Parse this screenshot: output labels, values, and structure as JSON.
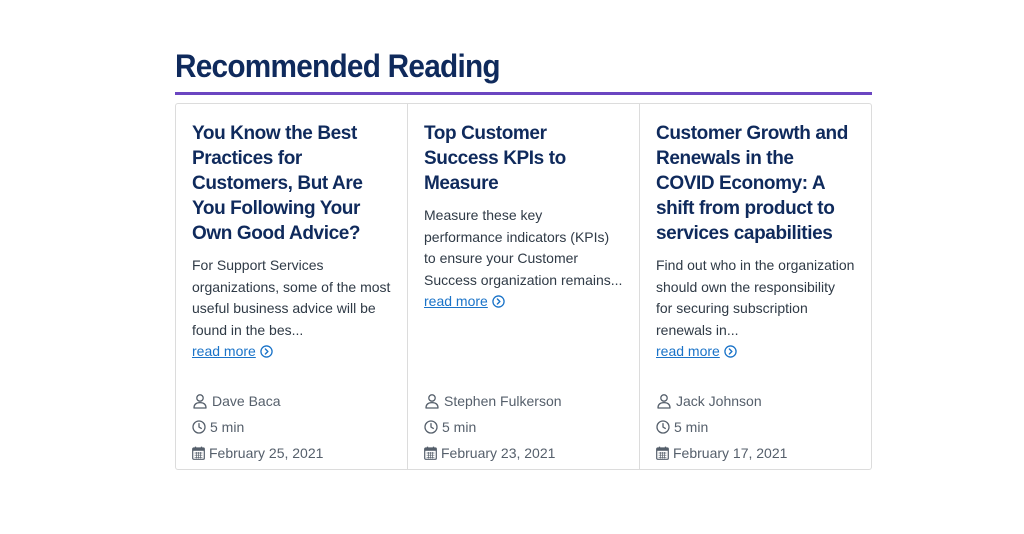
{
  "section": {
    "title": "Recommended Reading"
  },
  "cards": [
    {
      "title": "You Know the Best Practices for Customers, But Are You Following Your Own Good Advice?",
      "excerpt": "For Support Services organizations, some of the most useful business advice will be found in the bes...",
      "read_more": "read more",
      "author": "Dave Baca",
      "read_time": "5 min",
      "date": "February 25, 2021"
    },
    {
      "title": "Top Customer Success KPIs to Measure",
      "excerpt": "Measure these key performance indicators (KPIs) to ensure your Customer Success organization remains...",
      "read_more": "read more",
      "author": "Stephen Fulkerson",
      "read_time": "5 min",
      "date": "February 23, 2021"
    },
    {
      "title": "Customer Growth and Renewals in the COVID Economy: A shift from product to services capabilities",
      "excerpt": "Find out who in the organization should own the responsibility for securing subscription renewals in...",
      "read_more": "read more",
      "author": "Jack Johnson",
      "read_time": "5 min",
      "date": "February 17, 2021"
    }
  ],
  "colors": {
    "heading": "#0f2a5c",
    "accent_rule": "#6b46c1",
    "link": "#1a73c8",
    "meta_text": "#555f6b",
    "border": "#dcdcdc"
  },
  "icons": {
    "author": "user-icon",
    "read_time": "clock-icon",
    "date": "calendar-icon",
    "read_more": "circle-chevron-right-icon"
  }
}
